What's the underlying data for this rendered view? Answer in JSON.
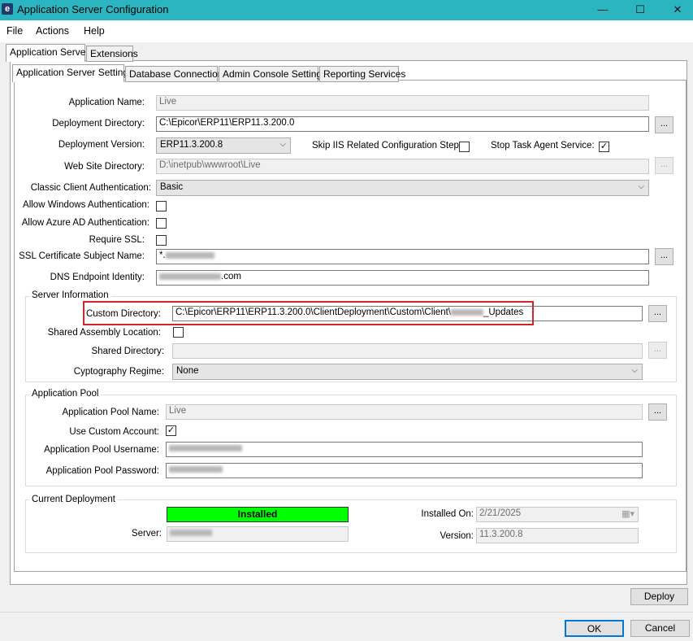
{
  "window": {
    "title": "Application Server Configuration",
    "icon_letter": "e",
    "controls": {
      "minimize": "—",
      "maximize": "☐",
      "close": "✕"
    }
  },
  "menu": {
    "items": [
      "File",
      "Actions",
      "Help"
    ]
  },
  "outer_tabs": [
    "Application Server",
    "Extensions"
  ],
  "inner_tabs": [
    "Application Server Settings",
    "Database Connection",
    "Admin Console Settings",
    "Reporting Services"
  ],
  "settings": {
    "application_name": {
      "label": "Application Name:",
      "value": "Live"
    },
    "deployment_directory": {
      "label": "Deployment Directory:",
      "value": "C:\\Epicor\\ERP11\\ERP11.3.200.0"
    },
    "deployment_version": {
      "label": "Deployment Version:",
      "value": "ERP11.3.200.8"
    },
    "skip_iis": {
      "label": "Skip IIS Related Configuration Steps:",
      "checked": false
    },
    "stop_task_agent": {
      "label": "Stop Task Agent Service:",
      "checked": true,
      "mark": "✓"
    },
    "web_site_directory": {
      "label": "Web Site Directory:",
      "value": "D:\\inetpub\\wwwroot\\Live"
    },
    "classic_client_auth": {
      "label": "Classic Client Authentication:",
      "value": "Basic"
    },
    "allow_windows_auth": {
      "label": "Allow Windows Authentication:",
      "checked": false
    },
    "allow_azure_auth": {
      "label": "Allow Azure AD Authentication:",
      "checked": false
    },
    "require_ssl": {
      "label": "Require SSL:",
      "checked": false
    },
    "ssl_subject": {
      "label": "SSL Certificate Subject Name:",
      "value_prefix": "*."
    },
    "dns_identity": {
      "label": "DNS Endpoint Identity:",
      "value_suffix": ".com"
    },
    "browse_label": "..."
  },
  "server_info": {
    "title": "Server Information",
    "custom_directory": {
      "label": "Custom Directory:",
      "value_prefix": "C:\\Epicor\\ERP11\\ERP11.3.200.0\\ClientDeployment\\Custom\\Client\\",
      "value_suffix": "_Updates"
    },
    "shared_assembly": {
      "label": "Shared Assembly Location:",
      "checked": false
    },
    "shared_directory": {
      "label": "Shared Directory:",
      "value": ""
    },
    "cryptography": {
      "label": "Cyptography Regime:",
      "value": "None"
    },
    "highlight_color": "#d0262a"
  },
  "app_pool": {
    "title": "Application Pool",
    "name": {
      "label": "Application Pool Name:",
      "value": "Live"
    },
    "use_custom_account": {
      "label": "Use Custom Account:",
      "checked": true,
      "mark": "✓"
    },
    "username": {
      "label": "Application Pool Username:"
    },
    "password": {
      "label": "Application Pool Password:"
    }
  },
  "deployment": {
    "title": "Current Deployment",
    "status": "Installed",
    "status_color": "#00ff00",
    "server_label": "Server:",
    "installed_on_label": "Installed On:",
    "installed_on": "2/21/2025",
    "version_label": "Version:",
    "version": "11.3.200.8"
  },
  "buttons": {
    "deploy": "Deploy",
    "ok": "OK",
    "cancel": "Cancel"
  },
  "icons": {
    "dropdown": "chevron-down-icon",
    "calendar": "calendar-icon"
  }
}
